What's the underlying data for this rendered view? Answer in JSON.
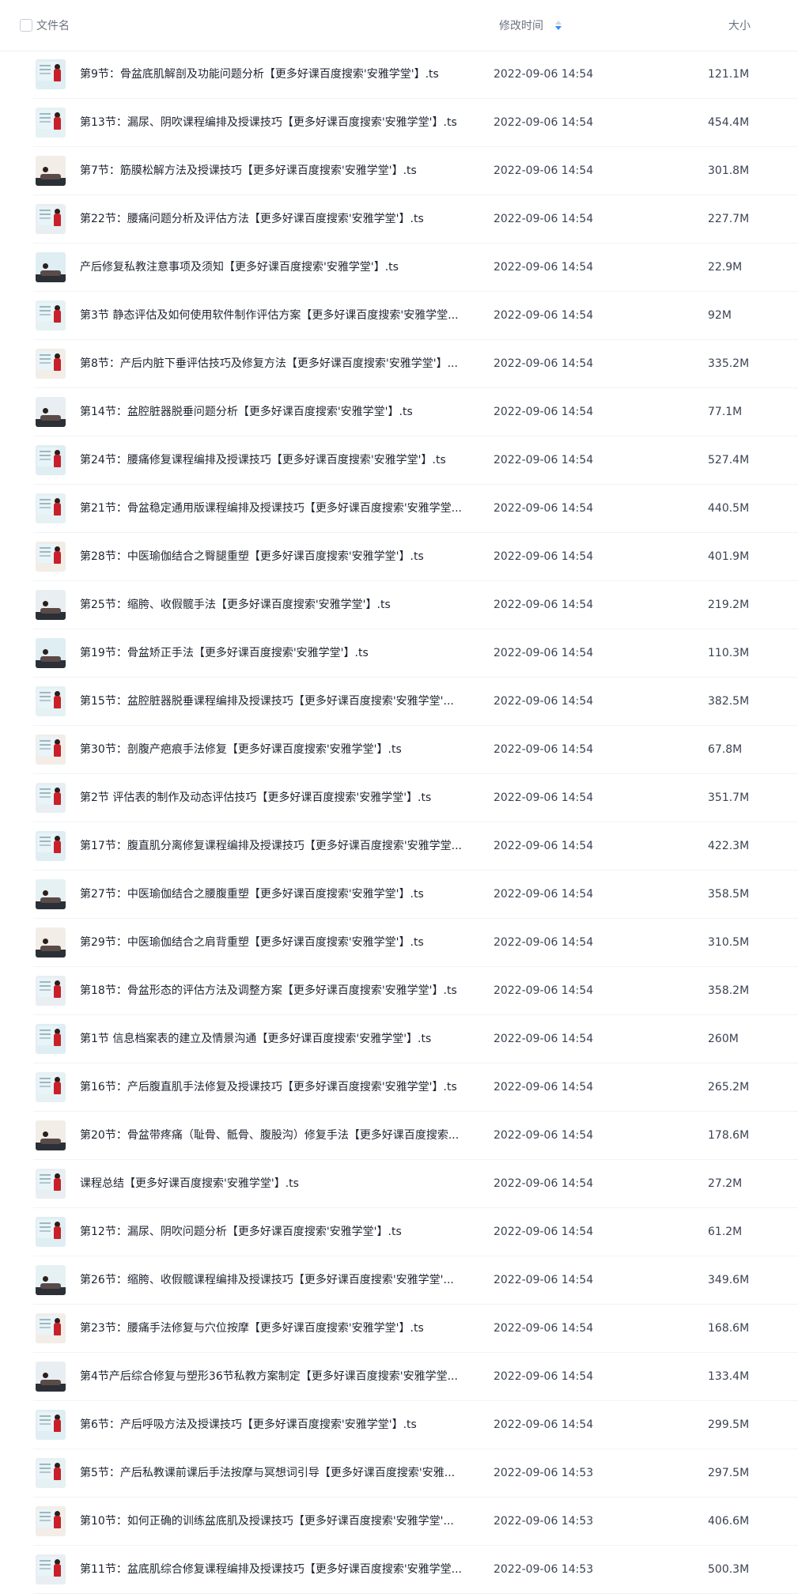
{
  "header": {
    "name_label": "文件名",
    "time_label": "修改时间",
    "size_label": "大小",
    "sort_icon": "sort-desc-icon",
    "sort_colors": {
      "up": "#cfd6df",
      "down": "#2f8cf7"
    }
  },
  "files": [
    {
      "name": "第9节：骨盆底肌解剖及功能问题分析【更多好课百度搜索'安雅学堂'】.ts",
      "time": "2022-09-06 14:54",
      "size": "121.1M"
    },
    {
      "name": "第13节：漏尿、阴吹课程编排及授课技巧【更多好课百度搜索'安雅学堂'】.ts",
      "time": "2022-09-06 14:54",
      "size": "454.4M"
    },
    {
      "name": "第7节：筋膜松解方法及授课技巧【更多好课百度搜索'安雅学堂'】.ts",
      "time": "2022-09-06 14:54",
      "size": "301.8M"
    },
    {
      "name": "第22节：腰痛问题分析及评估方法【更多好课百度搜索'安雅学堂'】.ts",
      "time": "2022-09-06 14:54",
      "size": "227.7M"
    },
    {
      "name": "产后修复私教注意事项及须知【更多好课百度搜索'安雅学堂'】.ts",
      "time": "2022-09-06 14:54",
      "size": "22.9M"
    },
    {
      "name": "第3节 静态评估及如何使用软件制作评估方案【更多好课百度搜索'安雅学堂...",
      "time": "2022-09-06 14:54",
      "size": "92M"
    },
    {
      "name": "第8节：产后内脏下垂评估技巧及修复方法【更多好课百度搜索'安雅学堂'】...",
      "time": "2022-09-06 14:54",
      "size": "335.2M"
    },
    {
      "name": "第14节：盆腔脏器脱垂问题分析【更多好课百度搜索'安雅学堂'】.ts",
      "time": "2022-09-06 14:54",
      "size": "77.1M"
    },
    {
      "name": "第24节：腰痛修复课程编排及授课技巧【更多好课百度搜索'安雅学堂'】.ts",
      "time": "2022-09-06 14:54",
      "size": "527.4M"
    },
    {
      "name": "第21节：骨盆稳定通用版课程编排及授课技巧【更多好课百度搜索'安雅学堂...",
      "time": "2022-09-06 14:54",
      "size": "440.5M"
    },
    {
      "name": "第28节：中医瑜伽结合之臀腿重塑【更多好课百度搜索'安雅学堂'】.ts",
      "time": "2022-09-06 14:54",
      "size": "401.9M"
    },
    {
      "name": "第25节：缩胯、收假髋手法【更多好课百度搜索'安雅学堂'】.ts",
      "time": "2022-09-06 14:54",
      "size": "219.2M"
    },
    {
      "name": "第19节：骨盆矫正手法【更多好课百度搜索'安雅学堂'】.ts",
      "time": "2022-09-06 14:54",
      "size": "110.3M"
    },
    {
      "name": "第15节：盆腔脏器脱垂课程编排及授课技巧【更多好课百度搜索'安雅学堂'...",
      "time": "2022-09-06 14:54",
      "size": "382.5M"
    },
    {
      "name": "第30节：剖腹产疤痕手法修复【更多好课百度搜索'安雅学堂'】.ts",
      "time": "2022-09-06 14:54",
      "size": "67.8M"
    },
    {
      "name": "第2节 评估表的制作及动态评估技巧【更多好课百度搜索'安雅学堂'】.ts",
      "time": "2022-09-06 14:54",
      "size": "351.7M"
    },
    {
      "name": "第17节：腹直肌分离修复课程编排及授课技巧【更多好课百度搜索'安雅学堂...",
      "time": "2022-09-06 14:54",
      "size": "422.3M"
    },
    {
      "name": "第27节：中医瑜伽结合之腰腹重塑【更多好课百度搜索'安雅学堂'】.ts",
      "time": "2022-09-06 14:54",
      "size": "358.5M"
    },
    {
      "name": "第29节：中医瑜伽结合之肩背重塑【更多好课百度搜索'安雅学堂'】.ts",
      "time": "2022-09-06 14:54",
      "size": "310.5M"
    },
    {
      "name": "第18节：骨盆形态的评估方法及调整方案【更多好课百度搜索'安雅学堂'】.ts",
      "time": "2022-09-06 14:54",
      "size": "358.2M"
    },
    {
      "name": "第1节 信息档案表的建立及情景沟通【更多好课百度搜索'安雅学堂'】.ts",
      "time": "2022-09-06 14:54",
      "size": "260M"
    },
    {
      "name": "第16节：产后腹直肌手法修复及授课技巧【更多好课百度搜索'安雅学堂'】.ts",
      "time": "2022-09-06 14:54",
      "size": "265.2M"
    },
    {
      "name": "第20节：骨盆带疼痛（耻骨、骶骨、腹股沟）修复手法【更多好课百度搜索...",
      "time": "2022-09-06 14:54",
      "size": "178.6M"
    },
    {
      "name": "课程总结【更多好课百度搜索'安雅学堂'】.ts",
      "time": "2022-09-06 14:54",
      "size": "27.2M"
    },
    {
      "name": "第12节：漏尿、阴吹问题分析【更多好课百度搜索'安雅学堂'】.ts",
      "time": "2022-09-06 14:54",
      "size": "61.2M"
    },
    {
      "name": "第26节：缩胯、收假髋课程编排及授课技巧【更多好课百度搜索'安雅学堂'...",
      "time": "2022-09-06 14:54",
      "size": "349.6M"
    },
    {
      "name": "第23节：腰痛手法修复与穴位按摩【更多好课百度搜索'安雅学堂'】.ts",
      "time": "2022-09-06 14:54",
      "size": "168.6M"
    },
    {
      "name": "第4节产后综合修复与塑形36节私教方案制定【更多好课百度搜索'安雅学堂...",
      "time": "2022-09-06 14:54",
      "size": "133.4M"
    },
    {
      "name": "第6节：产后呼吸方法及授课技巧【更多好课百度搜索'安雅学堂'】.ts",
      "time": "2022-09-06 14:54",
      "size": "299.5M"
    },
    {
      "name": "第5节：产后私教课前课后手法按摩与冥想词引导【更多好课百度搜索'安雅...",
      "time": "2022-09-06 14:53",
      "size": "297.5M"
    },
    {
      "name": "第10节：如何正确的训练盆底肌及授课技巧【更多好课百度搜索'安雅学堂'...",
      "time": "2022-09-06 14:53",
      "size": "406.6M"
    },
    {
      "name": "第11节：盆底肌综合修复课程编排及授课技巧【更多好课百度搜索'安雅学堂...",
      "time": "2022-09-06 14:53",
      "size": "500.3M"
    }
  ]
}
